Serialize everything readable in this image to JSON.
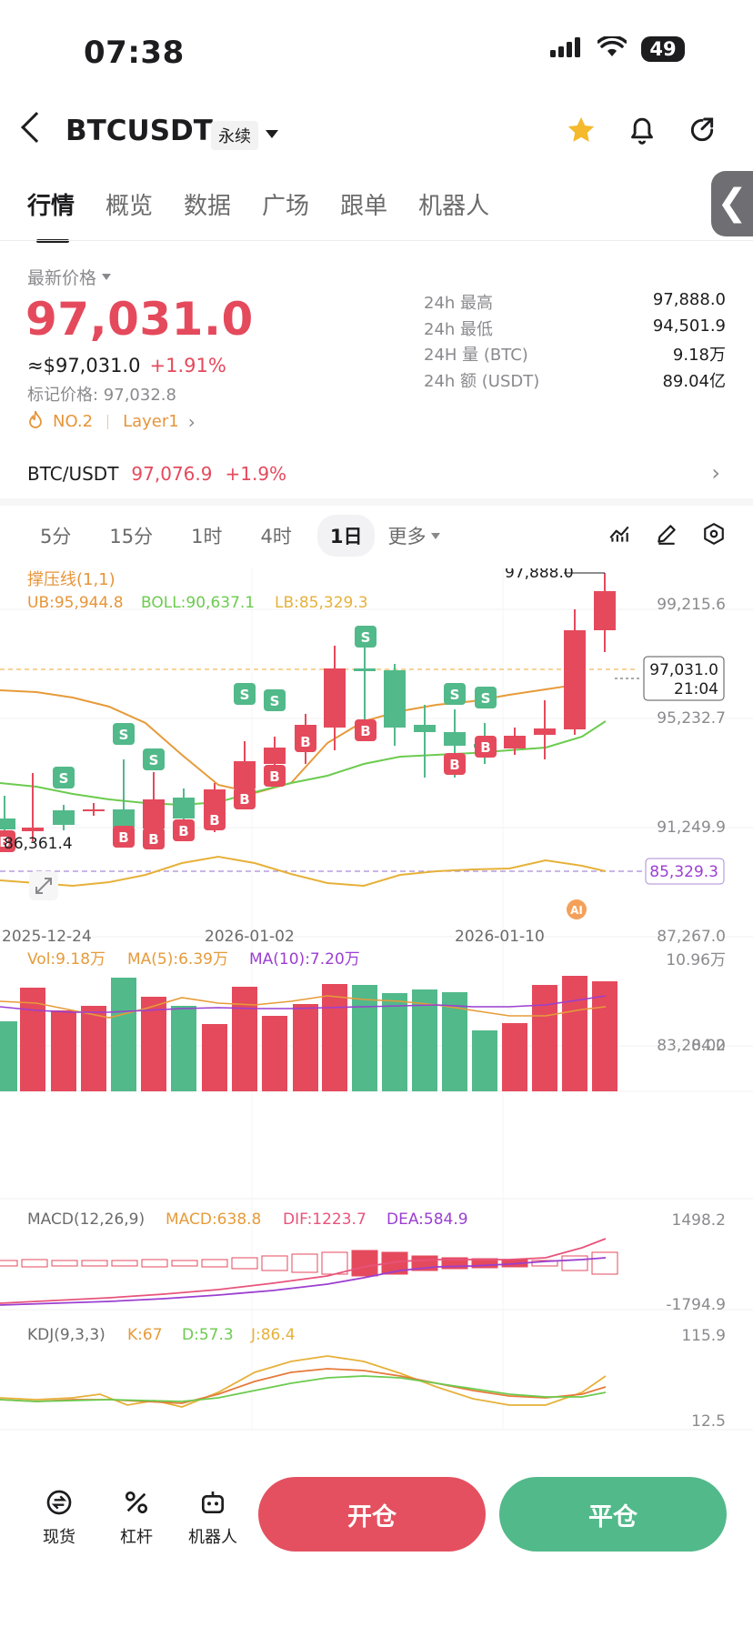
{
  "status_bar": {
    "time": "07:38",
    "battery": "49"
  },
  "header": {
    "symbol": "BTCUSDT",
    "contract_type": "永续"
  },
  "tabs": [
    "行情",
    "概览",
    "数据",
    "广场",
    "跟单",
    "机器人"
  ],
  "price": {
    "label": "最新价格",
    "last": "97,031.0",
    "usd": "≈$97,031.0",
    "change": "+1.91%",
    "mark": "标记价格: 97,032.8",
    "rank": "NO.2",
    "sector": "Layer1"
  },
  "stats": [
    {
      "label": "24h  最高",
      "value": "97,888.0"
    },
    {
      "label": "24h  最低",
      "value": "94,501.9"
    },
    {
      "label": "24H  量 (BTC)",
      "value": "9.18万"
    },
    {
      "label": "24h  额 (USDT)",
      "value": "89.04亿"
    }
  ],
  "spot_pair": {
    "name": "BTC/USDT",
    "price": "97,076.9",
    "change": "+1.9%"
  },
  "timeframes": [
    "5分",
    "15分",
    "1时",
    "4时",
    "1日"
  ],
  "timeframe_more": "更多",
  "indicators": {
    "main_title": "撑压线(1,1)",
    "ub": "UB:95,944.8",
    "boll": "BOLL:90,637.1",
    "lb": "LB:85,329.3",
    "vol": "Vol:9.18万",
    "ma5": "MA(5):6.39万",
    "ma10": "MA(10):7.20万",
    "macd_title": "MACD(12,26,9)",
    "macd": "MACD:638.8",
    "dif": "DIF:1223.7",
    "dea": "DEA:584.9",
    "kdj_title": "KDJ(9,3,3)",
    "k": "K:67",
    "d": "D:57.3",
    "j": "J:86.4"
  },
  "chart_labels": {
    "axis_price": [
      "99,215.6",
      "95,232.7",
      "91,249.9",
      "87,267.0",
      "83,284.2"
    ],
    "current_price": "97,031.0",
    "countdown": "21:04",
    "high_marker": "97,888.0",
    "low_marker": "86,361.4",
    "lb_tag": "85,329.3",
    "dates": [
      "2025-12-24",
      "2026-01-02",
      "2026-01-10"
    ],
    "vol_axis": [
      "10.96万",
      "0.00"
    ],
    "macd_axis": [
      "1498.2",
      "-1794.9"
    ],
    "kdj_axis": [
      "115.9",
      "12.5"
    ],
    "ai_badge": "AI"
  },
  "bottom_bar": {
    "spot": "现货",
    "leverage": "杠杆",
    "bot": "机器人",
    "open": "开仓",
    "close": "平仓"
  },
  "colors": {
    "up": "#e44a5c",
    "down": "#52b98a",
    "ub_line": "#e69b3a",
    "boll_line": "#6ccb4f",
    "lb_line": "#e6b13a",
    "ma10": "#9b3fd1",
    "macd": "#e69b3a",
    "dif": "#e8537b"
  },
  "chart_data": {
    "type": "candlestick",
    "x": [
      "2025-12-24",
      "2026-01-02",
      "2026-01-10"
    ],
    "y_axis_ticks": [
      99215.6,
      95232.7,
      91249.9,
      87267.0,
      83284.2
    ],
    "current_price": 97031.0,
    "high_24h": 97888.0,
    "low_marker": 86361.4,
    "bollinger": {
      "ub": 95944.8,
      "mid": 90637.1,
      "lb": 85329.3
    },
    "volume": {
      "last": "9.18万",
      "ma5": "6.39万",
      "ma10": "7.20万",
      "axis_max": "10.96万",
      "axis_min": "0.00"
    },
    "macd": {
      "macd": 638.8,
      "dif": 1223.7,
      "dea": 584.9,
      "axis_max": 1498.2,
      "axis_min": -1794.9
    },
    "kdj": {
      "k": 67,
      "d": 57.3,
      "j": 86.4,
      "axis_max": 115.9,
      "axis_min": 12.5
    }
  }
}
